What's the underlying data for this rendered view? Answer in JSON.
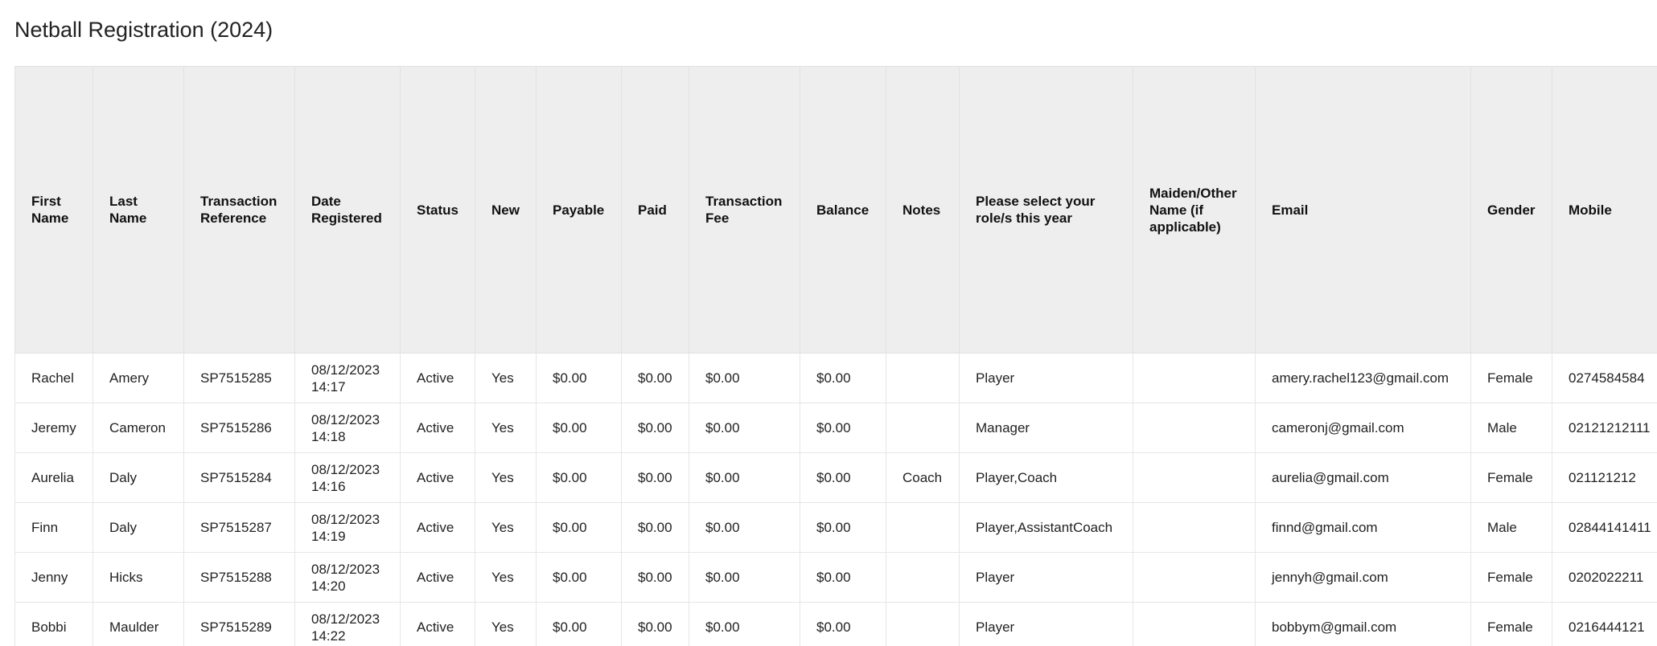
{
  "title": "Netball Registration (2024)",
  "columns": [
    {
      "key": "first_name",
      "label": "First Name"
    },
    {
      "key": "last_name",
      "label": "Last Name"
    },
    {
      "key": "transaction_reference",
      "label": "Transaction Reference"
    },
    {
      "key": "date_registered",
      "label": "Date Registered"
    },
    {
      "key": "status",
      "label": "Status"
    },
    {
      "key": "new",
      "label": "New"
    },
    {
      "key": "payable",
      "label": "Payable"
    },
    {
      "key": "paid",
      "label": "Paid"
    },
    {
      "key": "transaction_fee",
      "label": "Transaction Fee"
    },
    {
      "key": "balance",
      "label": "Balance"
    },
    {
      "key": "notes",
      "label": "Notes"
    },
    {
      "key": "roles",
      "label": "Please select your role/s this year"
    },
    {
      "key": "maiden_name",
      "label": "Maiden/Other Name (if applicable)"
    },
    {
      "key": "email",
      "label": "Email"
    },
    {
      "key": "gender",
      "label": "Gender"
    },
    {
      "key": "mobile",
      "label": "Mobile"
    }
  ],
  "rows": [
    {
      "first_name": "Rachel",
      "last_name": "Amery",
      "transaction_reference": "SP7515285",
      "date_registered": "08/12/2023 14:17",
      "status": "Active",
      "new": "Yes",
      "payable": "$0.00",
      "paid": "$0.00",
      "transaction_fee": "$0.00",
      "balance": "$0.00",
      "notes": "",
      "roles": "Player",
      "maiden_name": "",
      "email": "amery.rachel123@gmail.com",
      "gender": "Female",
      "mobile": "0274584584"
    },
    {
      "first_name": "Jeremy",
      "last_name": "Cameron",
      "transaction_reference": "SP7515286",
      "date_registered": "08/12/2023 14:18",
      "status": "Active",
      "new": "Yes",
      "payable": "$0.00",
      "paid": "$0.00",
      "transaction_fee": "$0.00",
      "balance": "$0.00",
      "notes": "",
      "roles": "Manager",
      "maiden_name": "",
      "email": "cameronj@gmail.com",
      "gender": "Male",
      "mobile": "02121212111"
    },
    {
      "first_name": "Aurelia",
      "last_name": "Daly",
      "transaction_reference": "SP7515284",
      "date_registered": "08/12/2023 14:16",
      "status": "Active",
      "new": "Yes",
      "payable": "$0.00",
      "paid": "$0.00",
      "transaction_fee": "$0.00",
      "balance": "$0.00",
      "notes": "Coach",
      "roles": "Player,Coach",
      "maiden_name": "",
      "email": "aurelia@gmail.com",
      "gender": "Female",
      "mobile": "021121212"
    },
    {
      "first_name": "Finn",
      "last_name": "Daly",
      "transaction_reference": "SP7515287",
      "date_registered": "08/12/2023 14:19",
      "status": "Active",
      "new": "Yes",
      "payable": "$0.00",
      "paid": "$0.00",
      "transaction_fee": "$0.00",
      "balance": "$0.00",
      "notes": "",
      "roles": "Player,AssistantCoach",
      "maiden_name": "",
      "email": "finnd@gmail.com",
      "gender": "Male",
      "mobile": "02844141411"
    },
    {
      "first_name": "Jenny",
      "last_name": "Hicks",
      "transaction_reference": "SP7515288",
      "date_registered": "08/12/2023 14:20",
      "status": "Active",
      "new": "Yes",
      "payable": "$0.00",
      "paid": "$0.00",
      "transaction_fee": "$0.00",
      "balance": "$0.00",
      "notes": "",
      "roles": "Player",
      "maiden_name": "",
      "email": "jennyh@gmail.com",
      "gender": "Female",
      "mobile": "0202022211"
    },
    {
      "first_name": "Bobbi",
      "last_name": "Maulder",
      "transaction_reference": "SP7515289",
      "date_registered": "08/12/2023 14:22",
      "status": "Active",
      "new": "Yes",
      "payable": "$0.00",
      "paid": "$0.00",
      "transaction_fee": "$0.00",
      "balance": "$0.00",
      "notes": "",
      "roles": "Player",
      "maiden_name": "",
      "email": "bobbym@gmail.com",
      "gender": "Female",
      "mobile": "0216444121"
    }
  ]
}
